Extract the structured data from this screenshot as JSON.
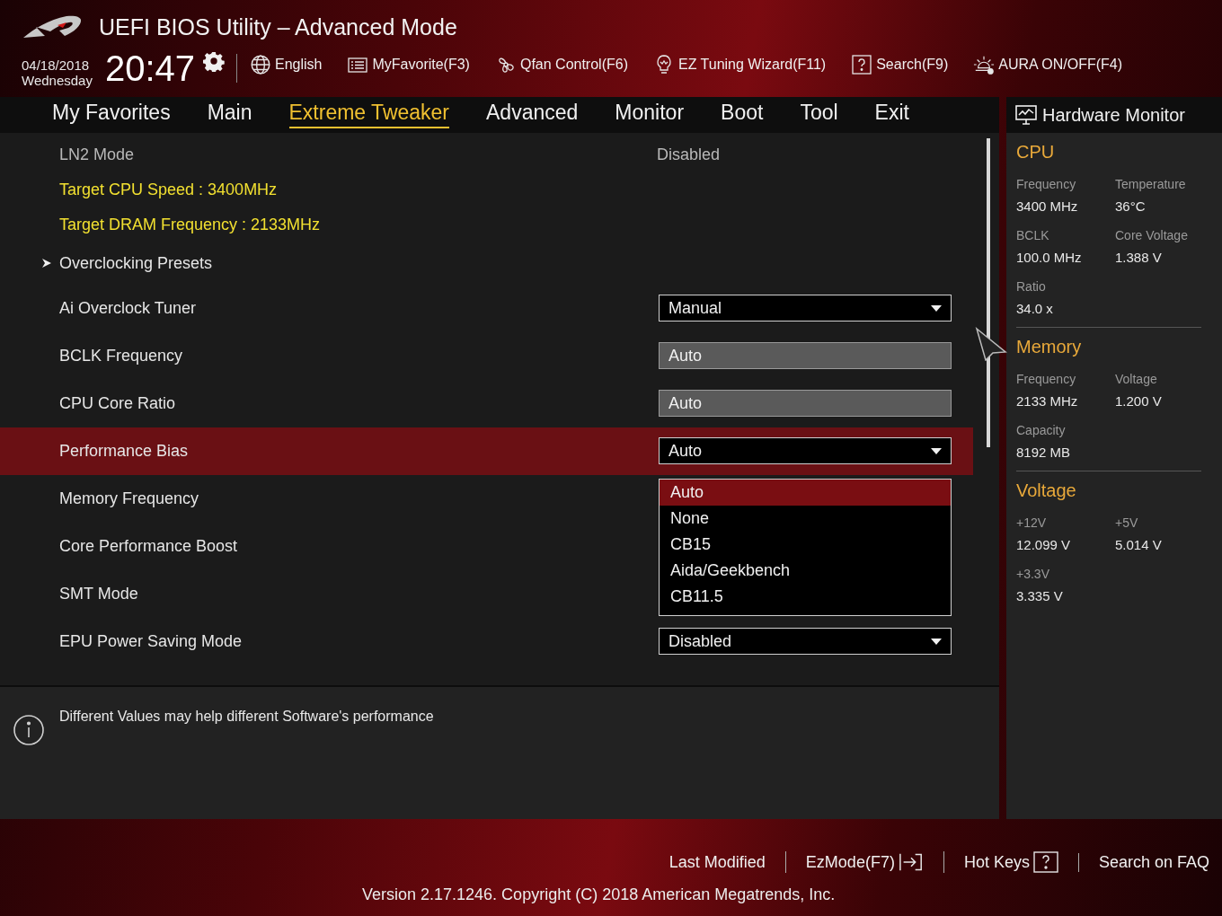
{
  "header": {
    "title": "UEFI BIOS Utility – Advanced Mode",
    "date": "04/18/2018",
    "weekday": "Wednesday",
    "time": "20:47",
    "toolbar": [
      {
        "kind": "globe",
        "label": "English"
      },
      {
        "kind": "list",
        "label": "MyFavorite(F3)"
      },
      {
        "kind": "fan",
        "label": "Qfan Control(F6)"
      },
      {
        "kind": "bulb",
        "label": "EZ Tuning Wizard(F11)"
      },
      {
        "kind": "help",
        "label": "Search(F9)"
      },
      {
        "kind": "aura",
        "label": "AURA ON/OFF(F4)"
      }
    ]
  },
  "tabs": [
    {
      "label": "My Favorites",
      "selected": false
    },
    {
      "label": "Main",
      "selected": false
    },
    {
      "label": "Extreme Tweaker",
      "selected": true
    },
    {
      "label": "Advanced",
      "selected": false
    },
    {
      "label": "Monitor",
      "selected": false
    },
    {
      "label": "Boot",
      "selected": false
    },
    {
      "label": "Tool",
      "selected": false
    },
    {
      "label": "Exit",
      "selected": false
    }
  ],
  "settings": [
    {
      "kind": "text",
      "label": "LN2 Mode",
      "value": "Disabled",
      "selected": false
    },
    {
      "kind": "highlight",
      "label": "Target CPU Speed : 3400MHz",
      "selected": false
    },
    {
      "kind": "highlight",
      "label": "Target DRAM Frequency : 2133MHz",
      "selected": false
    },
    {
      "kind": "submenu",
      "label": "Overclocking Presets",
      "selected": false
    },
    {
      "kind": "dropdown",
      "label": "Ai Overclock Tuner",
      "value": "Manual",
      "selected": false
    },
    {
      "kind": "field",
      "label": "BCLK Frequency",
      "value": "Auto",
      "selected": false
    },
    {
      "kind": "field",
      "label": "CPU Core Ratio",
      "value": "Auto",
      "selected": false
    },
    {
      "kind": "dropdown",
      "label": "Performance Bias",
      "value": "Auto",
      "selected": true,
      "options": [
        {
          "label": "Auto",
          "selected": true
        },
        {
          "label": "None",
          "selected": false
        },
        {
          "label": "CB15",
          "selected": false
        },
        {
          "label": "Aida/Geekbench",
          "selected": false
        },
        {
          "label": "CB11.5",
          "selected": false
        }
      ]
    },
    {
      "kind": "setting",
      "label": "Memory Frequency",
      "selected": false
    },
    {
      "kind": "setting",
      "label": "Core Performance Boost",
      "selected": false
    },
    {
      "kind": "setting",
      "label": "SMT Mode",
      "selected": false
    },
    {
      "kind": "dropdown",
      "label": "EPU Power Saving Mode",
      "value": "Disabled",
      "selected": false
    }
  ],
  "help_text": "Different Values may help different Software's performance",
  "hardware_monitor": {
    "title": "Hardware Monitor",
    "sections": [
      {
        "title": "CPU",
        "items": [
          {
            "label": "Frequency",
            "value": "3400 MHz"
          },
          {
            "label": "Temperature",
            "value": "36°C"
          },
          {
            "label": "BCLK",
            "value": "100.0 MHz"
          },
          {
            "label": "Core Voltage",
            "value": "1.388 V"
          },
          {
            "label": "Ratio",
            "value": "34.0 x"
          }
        ]
      },
      {
        "title": "Memory",
        "items": [
          {
            "label": "Frequency",
            "value": "2133 MHz"
          },
          {
            "label": "Voltage",
            "value": "1.200 V"
          },
          {
            "label": "Capacity",
            "value": "8192 MB"
          }
        ]
      },
      {
        "title": "Voltage",
        "items": [
          {
            "label": "+12V",
            "value": "12.099 V"
          },
          {
            "label": "+5V",
            "value": "5.014 V"
          },
          {
            "label": "+3.3V",
            "value": "3.335 V"
          }
        ]
      }
    ]
  },
  "footer": {
    "links": [
      {
        "kind": "plain",
        "label": "Last Modified"
      },
      {
        "kind": "exit",
        "label": "EzMode(F7)"
      },
      {
        "kind": "help",
        "label": "Hot Keys"
      },
      {
        "kind": "plain",
        "label": "Search on FAQ"
      }
    ],
    "version": "Version 2.17.1246. Copyright (C) 2018 American Megatrends, Inc."
  }
}
